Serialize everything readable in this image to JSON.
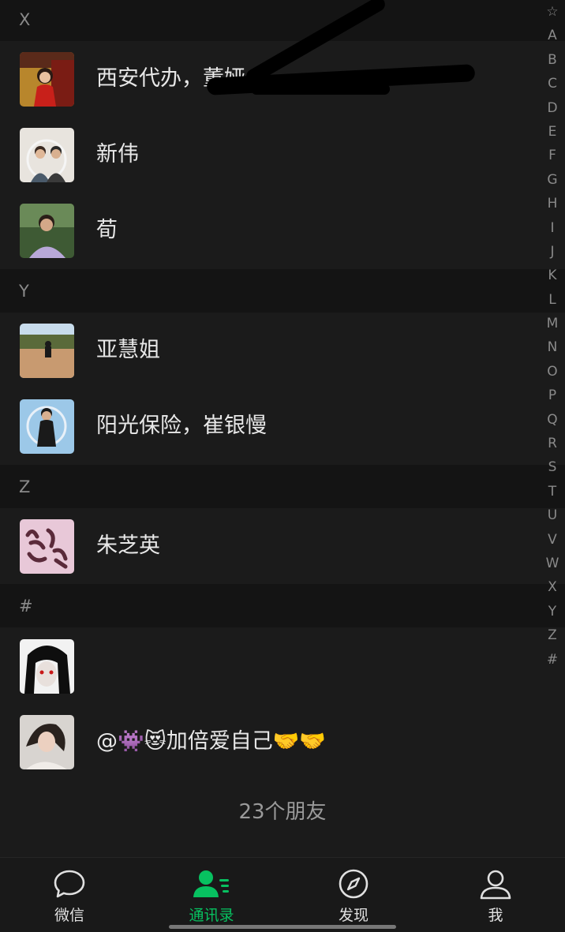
{
  "sections": [
    {
      "letter": "X"
    },
    {
      "letter": "Y"
    },
    {
      "letter": "Z"
    },
    {
      "letter": "#"
    }
  ],
  "contacts": [
    {
      "name": "西安代办，董娅"
    },
    {
      "name": "新伟"
    },
    {
      "name": "荀"
    },
    {
      "name": "亚慧姐"
    },
    {
      "name": "阳光保险，崔银慢"
    },
    {
      "name": "朱芝英"
    },
    {
      "name": ""
    },
    {
      "name": "@👾😻加倍爱自己🤝🤝"
    }
  ],
  "index_bar": [
    "☆",
    "A",
    "B",
    "C",
    "D",
    "E",
    "F",
    "G",
    "H",
    "I",
    "J",
    "K",
    "L",
    "M",
    "N",
    "O",
    "P",
    "Q",
    "R",
    "S",
    "T",
    "U",
    "V",
    "W",
    "X",
    "Y",
    "Z",
    "#"
  ],
  "footer": {
    "count": "23个朋友"
  },
  "tabs": [
    {
      "label": "微信",
      "icon": "chat-bubble-icon",
      "active": false
    },
    {
      "label": "通讯录",
      "icon": "contacts-icon",
      "active": true
    },
    {
      "label": "发现",
      "icon": "compass-icon",
      "active": false
    },
    {
      "label": "我",
      "icon": "person-icon",
      "active": false
    }
  ],
  "colors": {
    "accent": "#07c160",
    "background": "#1b1b1b",
    "section_bg": "#141414"
  }
}
